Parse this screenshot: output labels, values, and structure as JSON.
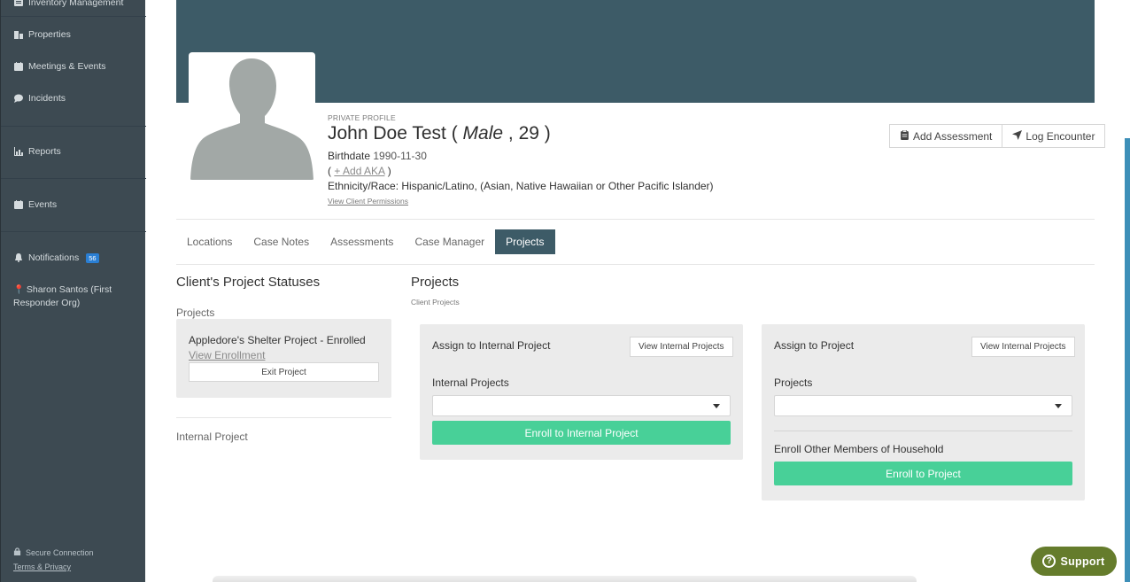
{
  "sidebar": {
    "items": [
      {
        "label": "Inventory Management",
        "icon": "inventory-icon"
      },
      {
        "label": "Properties",
        "icon": "building-icon"
      },
      {
        "label": "Meetings & Events",
        "icon": "calendar-icon"
      },
      {
        "label": "Incidents",
        "icon": "chat-icon"
      },
      {
        "label": "Reports",
        "icon": "bar-chart-icon"
      },
      {
        "label": "Events",
        "icon": "calendar-icon"
      },
      {
        "label": "Notifications",
        "icon": "bell-icon",
        "badge": "56"
      }
    ],
    "user": "Sharon Santos (First Responder Org)",
    "footer": {
      "secure": "Secure Connection",
      "terms": "Terms & Privacy"
    }
  },
  "profile": {
    "private_label": "PRIVATE PROFILE",
    "name": "John Doe Test",
    "gender": "Male",
    "age": "29",
    "birthdate_label": "Birthdate",
    "birthdate": "1990-11-30",
    "add_aka": "+ Add AKA",
    "ethnicity_label": "Ethnicity/Race:",
    "ethnicity": "Hispanic/Latino, (Asian, Native Hawaiian or Other Pacific Islander)",
    "permissions_link": "View Client Permissions"
  },
  "actions": {
    "add_assessment": "Add Assessment",
    "log_encounter": "Log Encounter"
  },
  "tabs": [
    {
      "label": "Locations",
      "active": false
    },
    {
      "label": "Case Notes",
      "active": false
    },
    {
      "label": "Assessments",
      "active": false
    },
    {
      "label": "Case Manager",
      "active": false
    },
    {
      "label": "Projects",
      "active": true
    }
  ],
  "statuses": {
    "title": "Client's Project Statuses",
    "projects_label": "Projects",
    "card": {
      "title": "Appledore's Shelter Project - Enrolled",
      "view_link": "View Enrollment",
      "exit_button": "Exit Project"
    },
    "internal_label": "Internal Project"
  },
  "projects": {
    "title": "Projects",
    "caption": "Client Projects",
    "internal_card": {
      "title": "Assign to Internal Project",
      "view_button": "View Internal Projects",
      "field_label": "Internal Projects",
      "select_value": "",
      "enroll_button": "Enroll to Internal Project"
    },
    "project_card": {
      "title": "Assign to Project",
      "view_button": "View Internal Projects",
      "field_label": "Projects",
      "select_value": "",
      "household_label": "Enroll Other Members of Household",
      "enroll_button": "Enroll to Project"
    }
  },
  "support": {
    "label": "Support"
  },
  "colors": {
    "sidebar": "#3d4a52",
    "banner": "#3d5b67",
    "accent_green": "#48d098",
    "support": "#657c2c"
  }
}
